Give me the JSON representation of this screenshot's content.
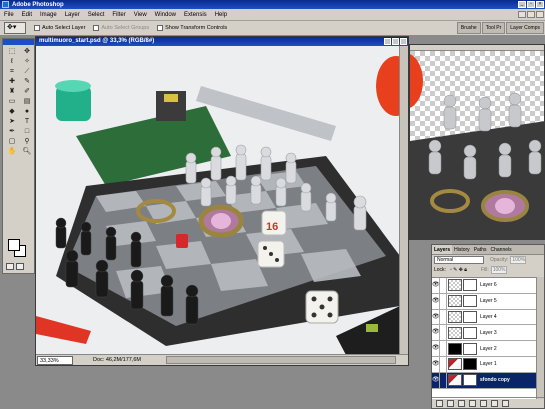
{
  "app": {
    "title": "Adobe Photoshop"
  },
  "menu": [
    "File",
    "Edit",
    "Image",
    "Layer",
    "Select",
    "Filter",
    "View",
    "Window",
    "Extensis",
    "Help"
  ],
  "options": {
    "auto_select_layer": "Auto Select Layer",
    "auto_select_groups": "Auto Select Groups",
    "show_transform_controls": "Show Transform Controls"
  },
  "palette_wells": [
    "Brushe",
    "Tool Pr",
    "Layer Comps"
  ],
  "document": {
    "title": "multimuoro_start.psd @ 33,3% (RGB/8#)",
    "zoom": "33,33%",
    "doc_info": "Doc: 46,2M/177,6M"
  },
  "layers_panel": {
    "tabs": [
      "Layers",
      "History",
      "Paths",
      "Channels"
    ],
    "active_tab": "Layers",
    "blend_mode": "Normal",
    "opacity_label": "Opacity:",
    "opacity": "100%",
    "lock_label": "Lock:",
    "fill_label": "Fill:",
    "fill": "100%",
    "layers": [
      {
        "name": "Layer 6",
        "visible": true,
        "selected": false,
        "thumb": "checker"
      },
      {
        "name": "Layer 5",
        "visible": true,
        "selected": false,
        "thumb": "checker"
      },
      {
        "name": "Layer 4",
        "visible": true,
        "selected": false,
        "thumb": "checker"
      },
      {
        "name": "Layer 3",
        "visible": true,
        "selected": false,
        "thumb": "checker"
      },
      {
        "name": "Layer 2",
        "visible": true,
        "selected": false,
        "thumb": "black"
      },
      {
        "name": "Layer 1",
        "visible": true,
        "selected": false,
        "thumb": "photo"
      },
      {
        "name": "sfondo copy",
        "visible": true,
        "selected": true,
        "thumb": "photo"
      }
    ]
  },
  "toolbox": {
    "tools": [
      "marquee",
      "move",
      "lasso",
      "magic-wand",
      "crop",
      "slice",
      "healing",
      "brush",
      "stamp",
      "history-brush",
      "eraser",
      "gradient",
      "blur",
      "dodge",
      "path-select",
      "type",
      "pen",
      "shape",
      "notes",
      "eyedropper",
      "hand",
      "zoom"
    ],
    "foreground_color": "#ffffff",
    "background_color": "#ffffff"
  },
  "colors": {
    "title_bar": "#1c4fc6",
    "chrome": "#d4d0c8",
    "workspace": "#8a8a8a",
    "selection": "#0a246a"
  }
}
